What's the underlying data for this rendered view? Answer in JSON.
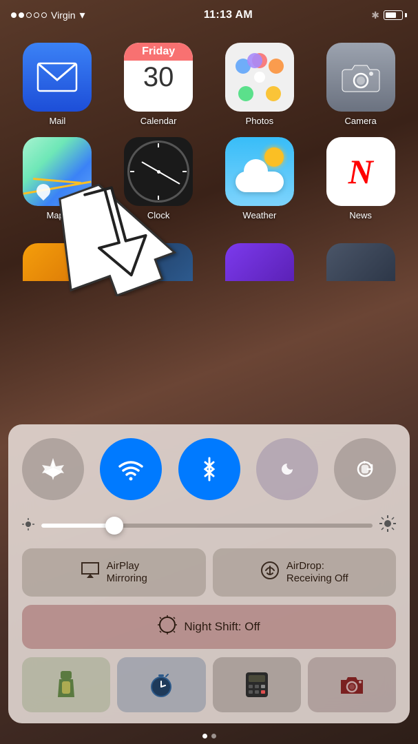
{
  "statusBar": {
    "carrier": "Virgin",
    "time": "11:13 AM",
    "signalDots": [
      true,
      true,
      false,
      false,
      false
    ]
  },
  "apps": {
    "row1": [
      {
        "name": "Mail",
        "icon": "mail"
      },
      {
        "name": "Calendar",
        "icon": "calendar",
        "day": "Friday",
        "date": "30"
      },
      {
        "name": "Photos",
        "icon": "photos"
      },
      {
        "name": "Camera",
        "icon": "camera"
      }
    ],
    "row2": [
      {
        "name": "Maps",
        "icon": "maps"
      },
      {
        "name": "Clock",
        "icon": "clock"
      },
      {
        "name": "Weather",
        "icon": "weather"
      },
      {
        "name": "News",
        "icon": "news"
      }
    ]
  },
  "controlCenter": {
    "toggles": [
      {
        "id": "airplane",
        "label": "Airplane Mode",
        "active": false,
        "symbol": "✈"
      },
      {
        "id": "wifi",
        "label": "Wi-Fi",
        "active": true,
        "symbol": "wifi"
      },
      {
        "id": "bluetooth",
        "label": "Bluetooth",
        "active": true,
        "symbol": "bluetooth"
      },
      {
        "id": "donotdisturb",
        "label": "Do Not Disturb",
        "active": false,
        "symbol": "moon"
      },
      {
        "id": "rotation",
        "label": "Rotation Lock",
        "active": false,
        "symbol": "rotation"
      }
    ],
    "brightnessLabel": "Brightness",
    "brightnessValue": 22,
    "actionButtons": [
      {
        "id": "airplay",
        "label": "AirPlay\nMirroring",
        "symbol": "airplay"
      },
      {
        "id": "airdrop",
        "label": "AirDrop:\nReceiving Off",
        "symbol": "airdrop"
      }
    ],
    "nightShift": {
      "label": "Night Shift: Off",
      "symbol": "halfmoon"
    },
    "quickIcons": [
      {
        "id": "flashlight",
        "label": "Flashlight",
        "symbol": "flashlight"
      },
      {
        "id": "timer",
        "label": "Timer",
        "symbol": "timer"
      },
      {
        "id": "calculator",
        "label": "Calculator",
        "symbol": "calculator"
      },
      {
        "id": "camera",
        "label": "Camera",
        "symbol": "camera"
      }
    ]
  },
  "pageDots": [
    true,
    false
  ],
  "arrow": {
    "visible": true
  }
}
